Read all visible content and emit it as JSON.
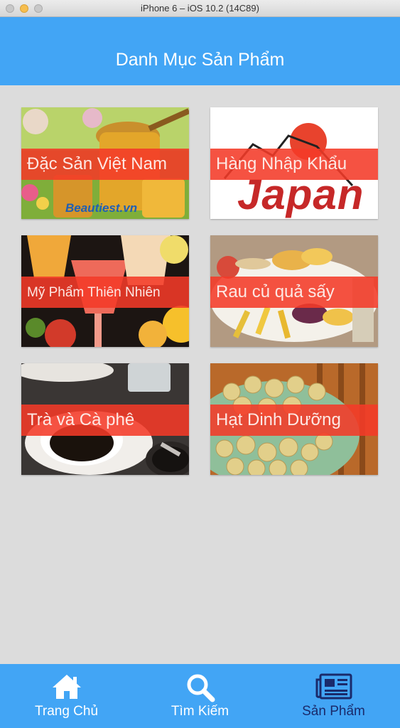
{
  "window": {
    "title": "iPhone 6 – iOS 10.2 (14C89)"
  },
  "header": {
    "title": "Danh Mục Sản Phẩm"
  },
  "categories": [
    {
      "label": "Đặc Sản Việt Nam"
    },
    {
      "label": "Hàng Nhập Khẩu"
    },
    {
      "label": "Mỹ Phẩm Thiên Nhiên"
    },
    {
      "label": "Rau củ quả sấy"
    },
    {
      "label": "Trà và Cà phê"
    },
    {
      "label": "Hạt Dinh Dưỡng"
    }
  ],
  "tiles_extra": {
    "watermark": "Beautiest.vn",
    "logo": "Japan"
  },
  "tabbar": {
    "tabs": [
      {
        "label": "Trang Chủ",
        "icon": "home-icon"
      },
      {
        "label": "Tìm Kiếm",
        "icon": "search-icon"
      },
      {
        "label": "Sản Phẩm",
        "icon": "newspaper-icon"
      }
    ],
    "active_index": 2
  },
  "colors": {
    "primary": "#42a5f5",
    "banner": "#f43a28",
    "active_tab": "#1a2a6b",
    "background": "#dcdcdc"
  }
}
